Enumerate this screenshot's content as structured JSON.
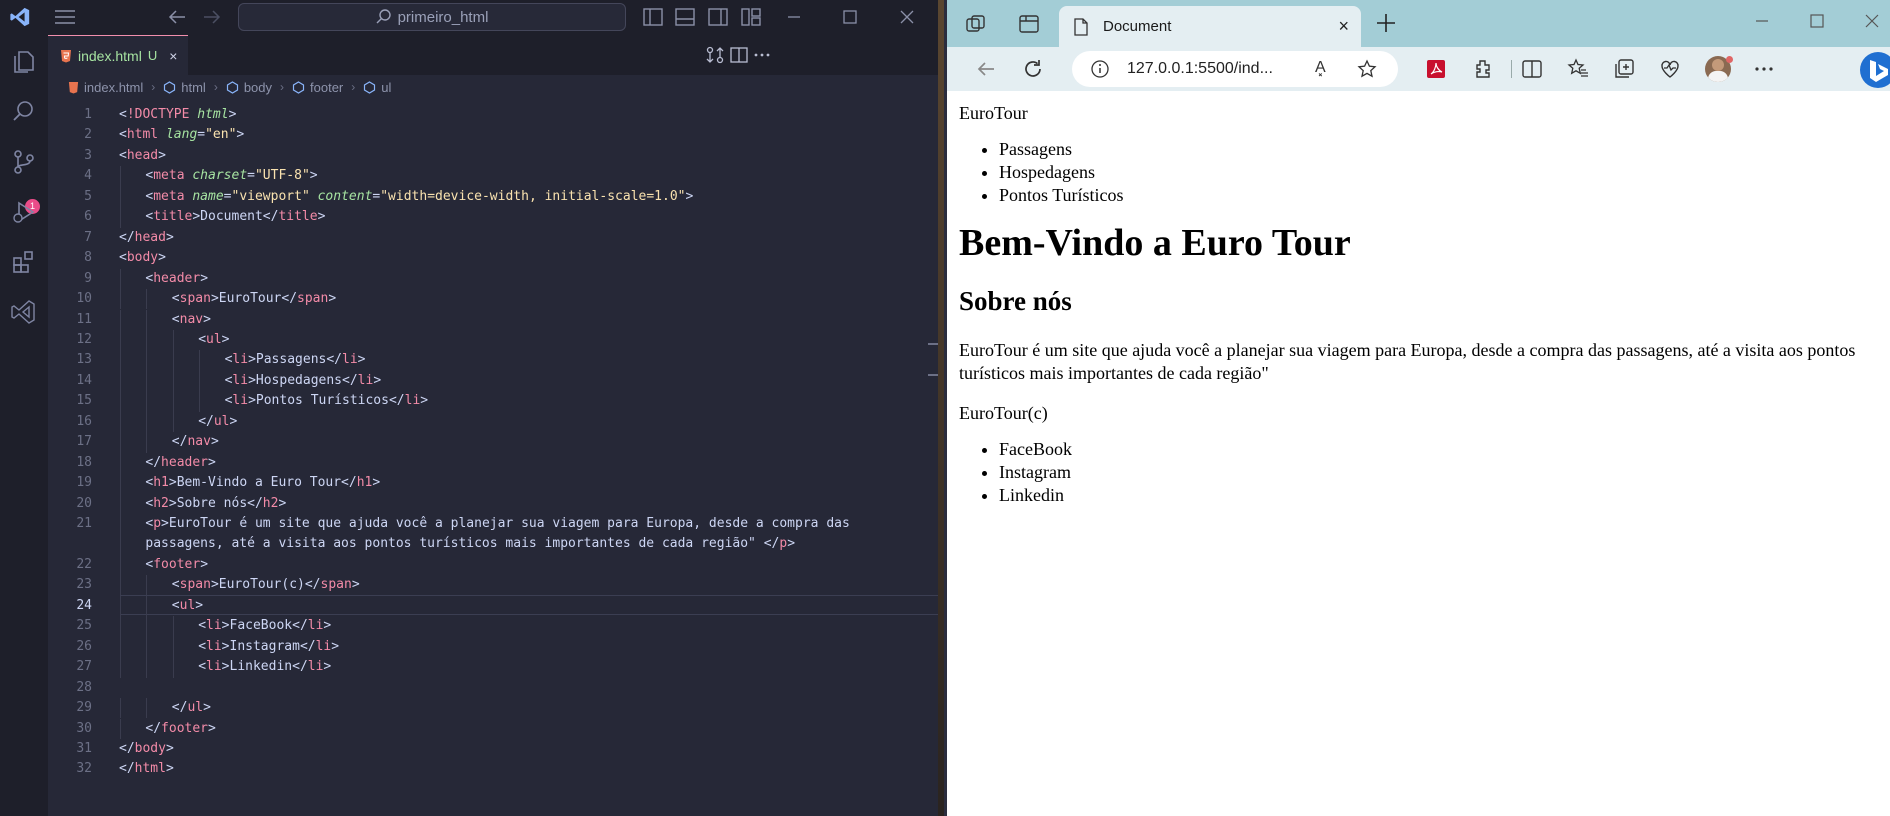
{
  "vscode": {
    "search_label": "primeiro_html",
    "source_control_badge": "1",
    "tab": {
      "name": "index.html",
      "status": "U",
      "close": "×"
    },
    "breadcrumb": [
      "index.html",
      "html",
      "body",
      "footer",
      "ul"
    ],
    "current_line": 24,
    "lines": [
      {
        "n": "1",
        "segs": [
          [
            "p",
            "<"
          ],
          [
            "t",
            "!DOCTYPE"
          ],
          [
            "p",
            " "
          ],
          [
            "a",
            "html"
          ],
          [
            "p",
            ">"
          ]
        ],
        "indent": 0
      },
      {
        "n": "2",
        "segs": [
          [
            "p",
            "<"
          ],
          [
            "t",
            "html"
          ],
          [
            "p",
            " "
          ],
          [
            "a",
            "lang"
          ],
          [
            "p",
            "="
          ],
          [
            "s",
            "\"en\""
          ],
          [
            "p",
            ">"
          ]
        ],
        "indent": 0
      },
      {
        "n": "3",
        "segs": [
          [
            "p",
            "<"
          ],
          [
            "t",
            "head"
          ],
          [
            "p",
            ">"
          ]
        ],
        "indent": 0
      },
      {
        "n": "4",
        "segs": [
          [
            "p",
            "<"
          ],
          [
            "t",
            "meta"
          ],
          [
            "p",
            " "
          ],
          [
            "a",
            "charset"
          ],
          [
            "p",
            "="
          ],
          [
            "s",
            "\"UTF-8\""
          ],
          [
            "p",
            ">"
          ]
        ],
        "indent": 1
      },
      {
        "n": "5",
        "segs": [
          [
            "p",
            "<"
          ],
          [
            "t",
            "meta"
          ],
          [
            "p",
            " "
          ],
          [
            "a",
            "name"
          ],
          [
            "p",
            "="
          ],
          [
            "s",
            "\"viewport\""
          ],
          [
            "p",
            " "
          ],
          [
            "a",
            "content"
          ],
          [
            "p",
            "="
          ],
          [
            "s",
            "\"width=device-width, initial-scale=1.0\""
          ],
          [
            "p",
            ">"
          ]
        ],
        "indent": 1
      },
      {
        "n": "6",
        "segs": [
          [
            "p",
            "<"
          ],
          [
            "t",
            "title"
          ],
          [
            "p",
            ">Document</"
          ],
          [
            "t",
            "title"
          ],
          [
            "p",
            ">"
          ]
        ],
        "indent": 1
      },
      {
        "n": "7",
        "segs": [
          [
            "p",
            "</"
          ],
          [
            "t",
            "head"
          ],
          [
            "p",
            ">"
          ]
        ],
        "indent": 0
      },
      {
        "n": "8",
        "segs": [
          [
            "p",
            "<"
          ],
          [
            "t",
            "body"
          ],
          [
            "p",
            ">"
          ]
        ],
        "indent": 0
      },
      {
        "n": "9",
        "segs": [
          [
            "p",
            "<"
          ],
          [
            "t",
            "header"
          ],
          [
            "p",
            ">"
          ]
        ],
        "indent": 1
      },
      {
        "n": "10",
        "segs": [
          [
            "p",
            "<"
          ],
          [
            "t",
            "span"
          ],
          [
            "p",
            ">EuroTour</"
          ],
          [
            "t",
            "span"
          ],
          [
            "p",
            ">"
          ]
        ],
        "indent": 2
      },
      {
        "n": "11",
        "segs": [
          [
            "p",
            "<"
          ],
          [
            "t",
            "nav"
          ],
          [
            "p",
            ">"
          ]
        ],
        "indent": 2
      },
      {
        "n": "12",
        "segs": [
          [
            "p",
            "<"
          ],
          [
            "t",
            "ul"
          ],
          [
            "p",
            ">"
          ]
        ],
        "indent": 3
      },
      {
        "n": "13",
        "segs": [
          [
            "p",
            "<"
          ],
          [
            "t",
            "li"
          ],
          [
            "p",
            ">Passagens</"
          ],
          [
            "t",
            "li"
          ],
          [
            "p",
            ">"
          ]
        ],
        "indent": 4
      },
      {
        "n": "14",
        "segs": [
          [
            "p",
            "<"
          ],
          [
            "t",
            "li"
          ],
          [
            "p",
            ">Hospedagens</"
          ],
          [
            "t",
            "li"
          ],
          [
            "p",
            ">"
          ]
        ],
        "indent": 4
      },
      {
        "n": "15",
        "segs": [
          [
            "p",
            "<"
          ],
          [
            "t",
            "li"
          ],
          [
            "p",
            ">Pontos Turísticos</"
          ],
          [
            "t",
            "li"
          ],
          [
            "p",
            ">"
          ]
        ],
        "indent": 4
      },
      {
        "n": "16",
        "segs": [
          [
            "p",
            "</"
          ],
          [
            "t",
            "ul"
          ],
          [
            "p",
            ">"
          ]
        ],
        "indent": 3
      },
      {
        "n": "17",
        "segs": [
          [
            "p",
            "</"
          ],
          [
            "t",
            "nav"
          ],
          [
            "p",
            ">"
          ]
        ],
        "indent": 2
      },
      {
        "n": "18",
        "segs": [
          [
            "p",
            "</"
          ],
          [
            "t",
            "header"
          ],
          [
            "p",
            ">"
          ]
        ],
        "indent": 1
      },
      {
        "n": "19",
        "segs": [
          [
            "p",
            "<"
          ],
          [
            "t",
            "h1"
          ],
          [
            "p",
            ">Bem-Vindo a Euro Tour</"
          ],
          [
            "t",
            "h1"
          ],
          [
            "p",
            ">"
          ]
        ],
        "indent": 1
      },
      {
        "n": "20",
        "segs": [
          [
            "p",
            "<"
          ],
          [
            "t",
            "h2"
          ],
          [
            "p",
            ">Sobre nós</"
          ],
          [
            "t",
            "h2"
          ],
          [
            "p",
            ">"
          ]
        ],
        "indent": 1
      },
      {
        "n": "21",
        "segs": [
          [
            "p",
            "<"
          ],
          [
            "t",
            "p"
          ],
          [
            "p",
            ">EuroTour é um site que ajuda você a planejar sua viagem para Europa, desde a compra das"
          ]
        ],
        "indent": 1
      },
      {
        "n": "",
        "segs": [
          [
            "p",
            "passagens, até a visita aos pontos turísticos mais importantes de cada região\" </"
          ],
          [
            "t",
            "p"
          ],
          [
            "p",
            ">"
          ]
        ],
        "indent": 1
      },
      {
        "n": "22",
        "segs": [
          [
            "p",
            "<"
          ],
          [
            "t",
            "footer"
          ],
          [
            "p",
            ">"
          ]
        ],
        "indent": 1
      },
      {
        "n": "23",
        "segs": [
          [
            "p",
            "<"
          ],
          [
            "t",
            "span"
          ],
          [
            "p",
            ">EuroTour(c)</"
          ],
          [
            "t",
            "span"
          ],
          [
            "p",
            ">"
          ]
        ],
        "indent": 2
      },
      {
        "n": "24",
        "segs": [
          [
            "p",
            "<"
          ],
          [
            "t",
            "ul"
          ],
          [
            "p",
            ">"
          ]
        ],
        "indent": 2
      },
      {
        "n": "25",
        "segs": [
          [
            "p",
            "<"
          ],
          [
            "t",
            "li"
          ],
          [
            "p",
            ">FaceBook</"
          ],
          [
            "t",
            "li"
          ],
          [
            "p",
            ">"
          ]
        ],
        "indent": 3
      },
      {
        "n": "26",
        "segs": [
          [
            "p",
            "<"
          ],
          [
            "t",
            "li"
          ],
          [
            "p",
            ">Instagram</"
          ],
          [
            "t",
            "li"
          ],
          [
            "p",
            ">"
          ]
        ],
        "indent": 3
      },
      {
        "n": "27",
        "segs": [
          [
            "p",
            "<"
          ],
          [
            "t",
            "li"
          ],
          [
            "p",
            ">Linkedin</"
          ],
          [
            "t",
            "li"
          ],
          [
            "p",
            ">"
          ]
        ],
        "indent": 3
      },
      {
        "n": "28",
        "segs": [],
        "indent": 0
      },
      {
        "n": "29",
        "segs": [
          [
            "p",
            "</"
          ],
          [
            "t",
            "ul"
          ],
          [
            "p",
            ">"
          ]
        ],
        "indent": 2
      },
      {
        "n": "30",
        "segs": [
          [
            "p",
            "</"
          ],
          [
            "t",
            "footer"
          ],
          [
            "p",
            ">"
          ]
        ],
        "indent": 1
      },
      {
        "n": "31",
        "segs": [
          [
            "p",
            "</"
          ],
          [
            "t",
            "body"
          ],
          [
            "p",
            ">"
          ]
        ],
        "indent": 0
      },
      {
        "n": "32",
        "segs": [
          [
            "p",
            "</"
          ],
          [
            "t",
            "html"
          ],
          [
            "p",
            ">"
          ]
        ],
        "indent": 0
      }
    ]
  },
  "browser": {
    "tab_title": "Document",
    "tab_close": "×",
    "address": "127.0.0.1:5500/ind...",
    "read_aloud": "A͓",
    "page": {
      "header_text": "EuroTour",
      "nav_items": [
        "Passagens",
        "Hospedagens",
        "Pontos Turísticos"
      ],
      "h1": "Bem-Vindo a Euro Tour",
      "h2": "Sobre nós",
      "paragraph": "EuroTour é um site que ajuda você a planejar sua viagem para Europa, desde a compra das passagens, até a visita aos pontos turísticos mais importantes de cada região\"",
      "footer_text": "EuroTour(c)",
      "footer_items": [
        "FaceBook",
        "Instagram",
        "Linkedin"
      ]
    }
  },
  "colors": {
    "tag": "#f38ba8",
    "attr": "#a6e3a1",
    "string": "#f9e2af",
    "edge_titlebar": "#a3cdd6"
  }
}
